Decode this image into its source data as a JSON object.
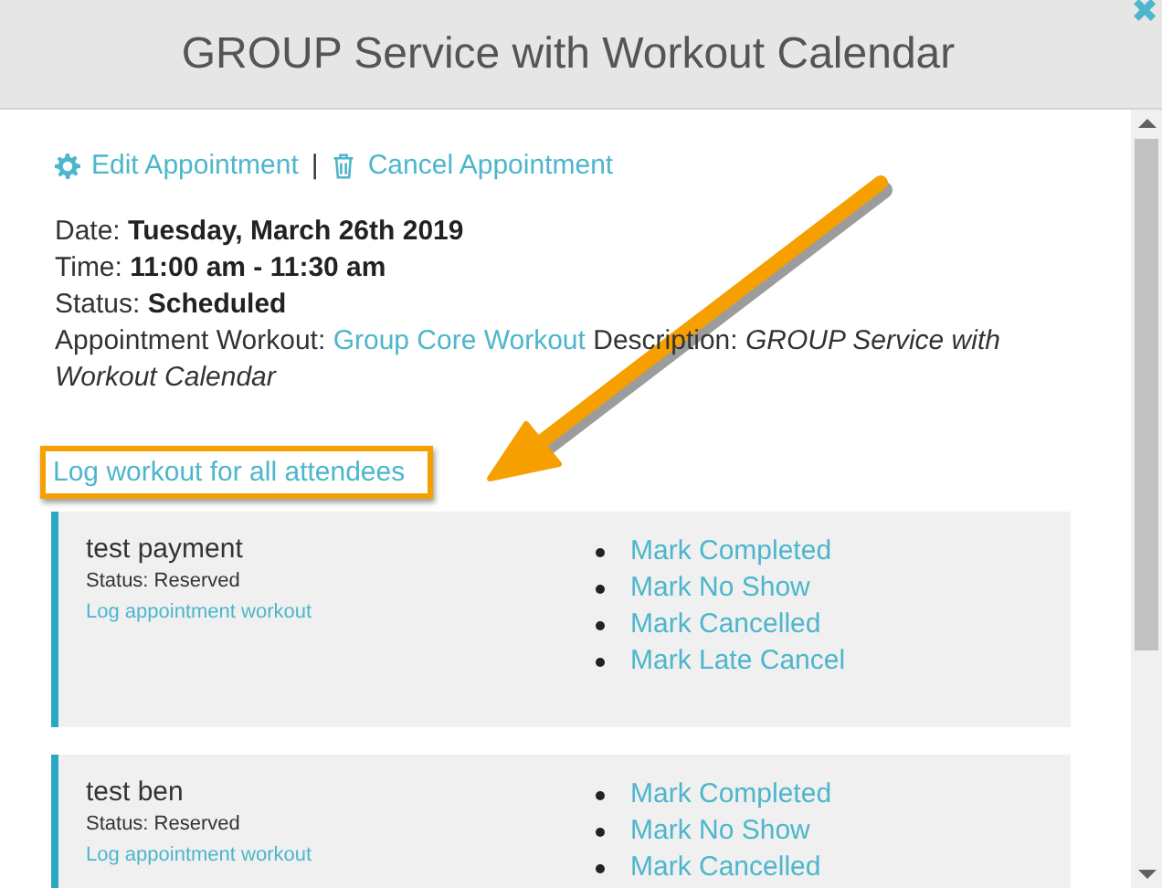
{
  "dialog": {
    "title": "GROUP Service with Workout Calendar",
    "close": "✖"
  },
  "actions": [
    {
      "kind": "edit",
      "label": "Edit Appointment"
    },
    {
      "kind": "cancel",
      "label": "Cancel Appointment"
    }
  ],
  "action_separator": "|",
  "details": [
    {
      "label": "Date:",
      "value": "Tuesday, March 26th 2019"
    },
    {
      "label": "Time:",
      "value": "11:00 am - 11:30 am"
    },
    {
      "label": "Status:",
      "value": "Scheduled"
    }
  ],
  "workout": {
    "label": "Appointment Workout:",
    "link": "Group Core Workout",
    "description_label": "Description:",
    "description": "GROUP Service with Workout Calendar"
  },
  "log_all_link": {
    "label": "Log workout for all attendees",
    "highlighted": true
  },
  "attendees": [
    {
      "name": "test payment",
      "status": "Status: Reserved",
      "log_link": "Log appointment workout",
      "marks": [
        "Mark Completed",
        "Mark No Show",
        "Mark Cancelled",
        "Mark Late Cancel"
      ]
    },
    {
      "name": "test ben",
      "status": "Status: Reserved",
      "log_link": "Log appointment workout",
      "marks": [
        "Mark Completed",
        "Mark No Show",
        "Mark Cancelled"
      ]
    }
  ]
}
